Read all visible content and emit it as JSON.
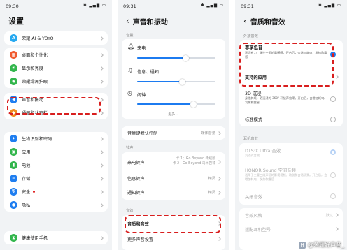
{
  "status": {
    "p1_time": "09:30",
    "p2_time": "09:31",
    "p3_time": "09:31",
    "icons": "✱ ▂▄▆ ▭"
  },
  "p1": {
    "title": "设置",
    "items": [
      {
        "label": "荣耀 AI & YOYO",
        "color": "#27a9f0",
        "glyph": "A"
      },
      {
        "label": "桌面和个性化",
        "color": "#f05a2f",
        "glyph": "▦"
      },
      {
        "label": "显示和亮度",
        "color": "#33b64d",
        "glyph": "☀"
      },
      {
        "label": "荣耀绿洲护眼",
        "color": "#33b64d",
        "glyph": "◉"
      },
      {
        "label": "声音和振动",
        "color": "#1f7ef0",
        "glyph": "◀"
      },
      {
        "label": "通知和状态栏",
        "color": "#f28d1e",
        "glyph": "◆"
      },
      {
        "label": "生物识别和密码",
        "color": "#1f7ef0",
        "glyph": "✦"
      },
      {
        "label": "应用",
        "color": "#33b64d",
        "glyph": "▣"
      },
      {
        "label": "电池",
        "color": "#33b64d",
        "glyph": "▮"
      },
      {
        "label": "存储",
        "color": "#1f7ef0",
        "glyph": "≡"
      },
      {
        "label": "安全",
        "color": "#1f7ef0",
        "glyph": "⛨"
      },
      {
        "label": "隐私",
        "color": "#1f7ef0",
        "glyph": "●"
      },
      {
        "label": "健康使用手机",
        "color": "#33b64d",
        "glyph": "⧗"
      }
    ]
  },
  "p2": {
    "title": "声音和振动",
    "sec_volume": "音量",
    "vol_ring": "来电",
    "vol_notify": "信息、通知",
    "vol_alarm": "闹钟",
    "more": "更多",
    "vol_key": "音量键默认控制",
    "vol_key_value": "媒体音量",
    "sec_ringtone": "铃声",
    "ringtone": "来电铃声",
    "ring_card1": "卡 1：Go Beyond 传统版",
    "ring_card2": "卡 2：Go Beyond 马林巴琴",
    "msg_tone": "信息铃声",
    "msg_value": "精灵",
    "notify_tone": "通知铃声",
    "notify_value": "精灵",
    "sec_sound": "音效",
    "quality": "音质和音效",
    "other": "更多声音设置",
    "volume_levels": {
      "ring": 0.62,
      "notify": 0.58,
      "alarm": 0.72
    }
  },
  "p3": {
    "title": "音质和音效",
    "sec_ext": "外放音效",
    "opt1_title": "尊享低音",
    "opt1_desc": "澎湃有力、弹性十足的震撼感。开启后，会增加耗电，发热和震感",
    "supported": "支持的应用",
    "opt2_title": "3D 沉浸",
    "opt2_desc": "身临其境，更沉浸的 360° 环绕声效果。开启后，会增加耗电、发热和震感",
    "opt3_title": "标准模式",
    "sec_ear": "耳机音效",
    "ear1_title": "DTS:X Ultra 音效",
    "ear1_desc": "沉浸式音效",
    "ear2_title": "HONOR Sound 空间音频",
    "ear2_desc": "适用于主要三维声场的影视视频、歌剧和会话场景。开启后，会增加耗电、发热和震感",
    "ear3_title": "关闭音效",
    "style_label": "音效风格",
    "style_value": "默认",
    "adapt_label": "适配耳机型号"
  },
  "watermark": "@荣耀好声音_",
  "colors": {
    "accent": "#1c7bf0",
    "highlight": "#d81e1e"
  }
}
